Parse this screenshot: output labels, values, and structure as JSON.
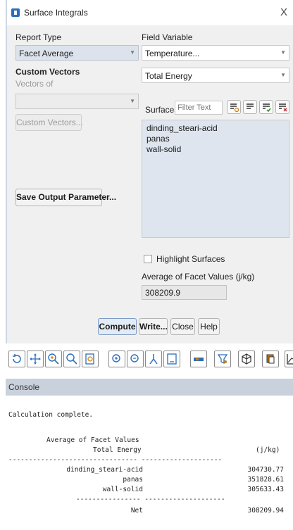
{
  "dialog": {
    "title": "Surface Integrals",
    "close_glyph": "X",
    "report_type": {
      "label": "Report Type",
      "value": "Facet Average"
    },
    "field_variable": {
      "label": "Field Variable",
      "category": "Temperature...",
      "value": "Total Energy"
    },
    "custom_vectors": {
      "heading": "Custom Vectors",
      "vectors_of_label": "Vectors of",
      "vectors_of_value": "",
      "button": "Custom Vectors..."
    },
    "save_output_button": "Save Output Parameter...",
    "surfaces": {
      "label": "Surfaces",
      "filter_placeholder": "Filter Text",
      "items": [
        "dinding_steari-acid",
        "panas",
        "wall-solid"
      ]
    },
    "highlight_surfaces": {
      "label": "Highlight Surfaces",
      "checked": false
    },
    "result": {
      "label": "Average of Facet Values (j/kg)",
      "value": "308209.9"
    },
    "buttons": {
      "compute": "Compute",
      "write": "Write...",
      "close": "Close",
      "help": "Help"
    }
  },
  "toolbar": {
    "icons": [
      "rotate-icon",
      "pan-icon",
      "zoom-in-icon",
      "zoom-icon",
      "zoom-box-icon",
      "zoom-plus-icon",
      "zoom-minus-icon",
      "probe-icon",
      "fit-icon",
      "ruler-icon",
      "filter-icon",
      "cube-icon",
      "copy-icon",
      "chart-icon"
    ]
  },
  "console": {
    "title": "Console",
    "message": "Calculation complete.",
    "header1": "Average of Facet Values",
    "header2_left": "Total Energy",
    "header2_right": "(j/kg)",
    "divider": "-------------------------------- --------------------",
    "rows": [
      {
        "name": "dinding_steari-acid",
        "value": "304730.77"
      },
      {
        "name": "panas",
        "value": "351828.61"
      },
      {
        "name": "wall-solid",
        "value": "305633.43"
      }
    ],
    "divider2": "---------------- --------------------",
    "net_label": "Net",
    "net_value": "308209.94"
  }
}
